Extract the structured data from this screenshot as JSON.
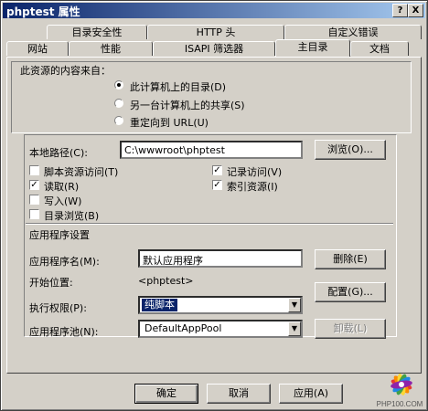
{
  "window": {
    "title": "phptest 属性",
    "help_btn": "?",
    "close_btn": "X"
  },
  "tabs_row1": [
    {
      "label": "目录安全性"
    },
    {
      "label": "HTTP 头"
    },
    {
      "label": "自定义错误"
    }
  ],
  "tabs_row2": [
    {
      "label": "网站"
    },
    {
      "label": "性能"
    },
    {
      "label": "ISAPI 筛选器"
    },
    {
      "label": "主目录",
      "active": true
    },
    {
      "label": "文档"
    }
  ],
  "source": {
    "heading": "此资源的内容来自：",
    "options": [
      {
        "label": "此计算机上的目录(D)",
        "selected": true
      },
      {
        "label": "另一台计算机上的共享(S)",
        "selected": false
      },
      {
        "label": "重定向到 URL(U)",
        "selected": false
      }
    ]
  },
  "local_path": {
    "label": "本地路径(C):",
    "value": "C:\\wwwroot\\phptest",
    "browse": "浏览(O)..."
  },
  "permissions": {
    "left": [
      {
        "label": "脚本资源访问(T)",
        "checked": false
      },
      {
        "label": "读取(R)",
        "checked": true
      },
      {
        "label": "写入(W)",
        "checked": false
      },
      {
        "label": "目录浏览(B)",
        "checked": false
      }
    ],
    "right": [
      {
        "label": "记录访问(V)",
        "checked": true
      },
      {
        "label": "索引资源(I)",
        "checked": true
      }
    ]
  },
  "app_settings": {
    "heading": "应用程序设置",
    "app_name_label": "应用程序名(M):",
    "app_name_value": "默认应用程序",
    "remove": "删除(E)",
    "start_label": "开始位置:",
    "start_value": "<phptest>",
    "config": "配置(G)...",
    "exec_label": "执行权限(P):",
    "exec_value": "纯脚本",
    "pool_label": "应用程序池(N):",
    "pool_value": "DefaultAppPool",
    "unload": "卸载(L)"
  },
  "footer": {
    "ok": "确定",
    "cancel": "取消",
    "apply": "应用(A)"
  },
  "watermark": "PHP100.COM"
}
